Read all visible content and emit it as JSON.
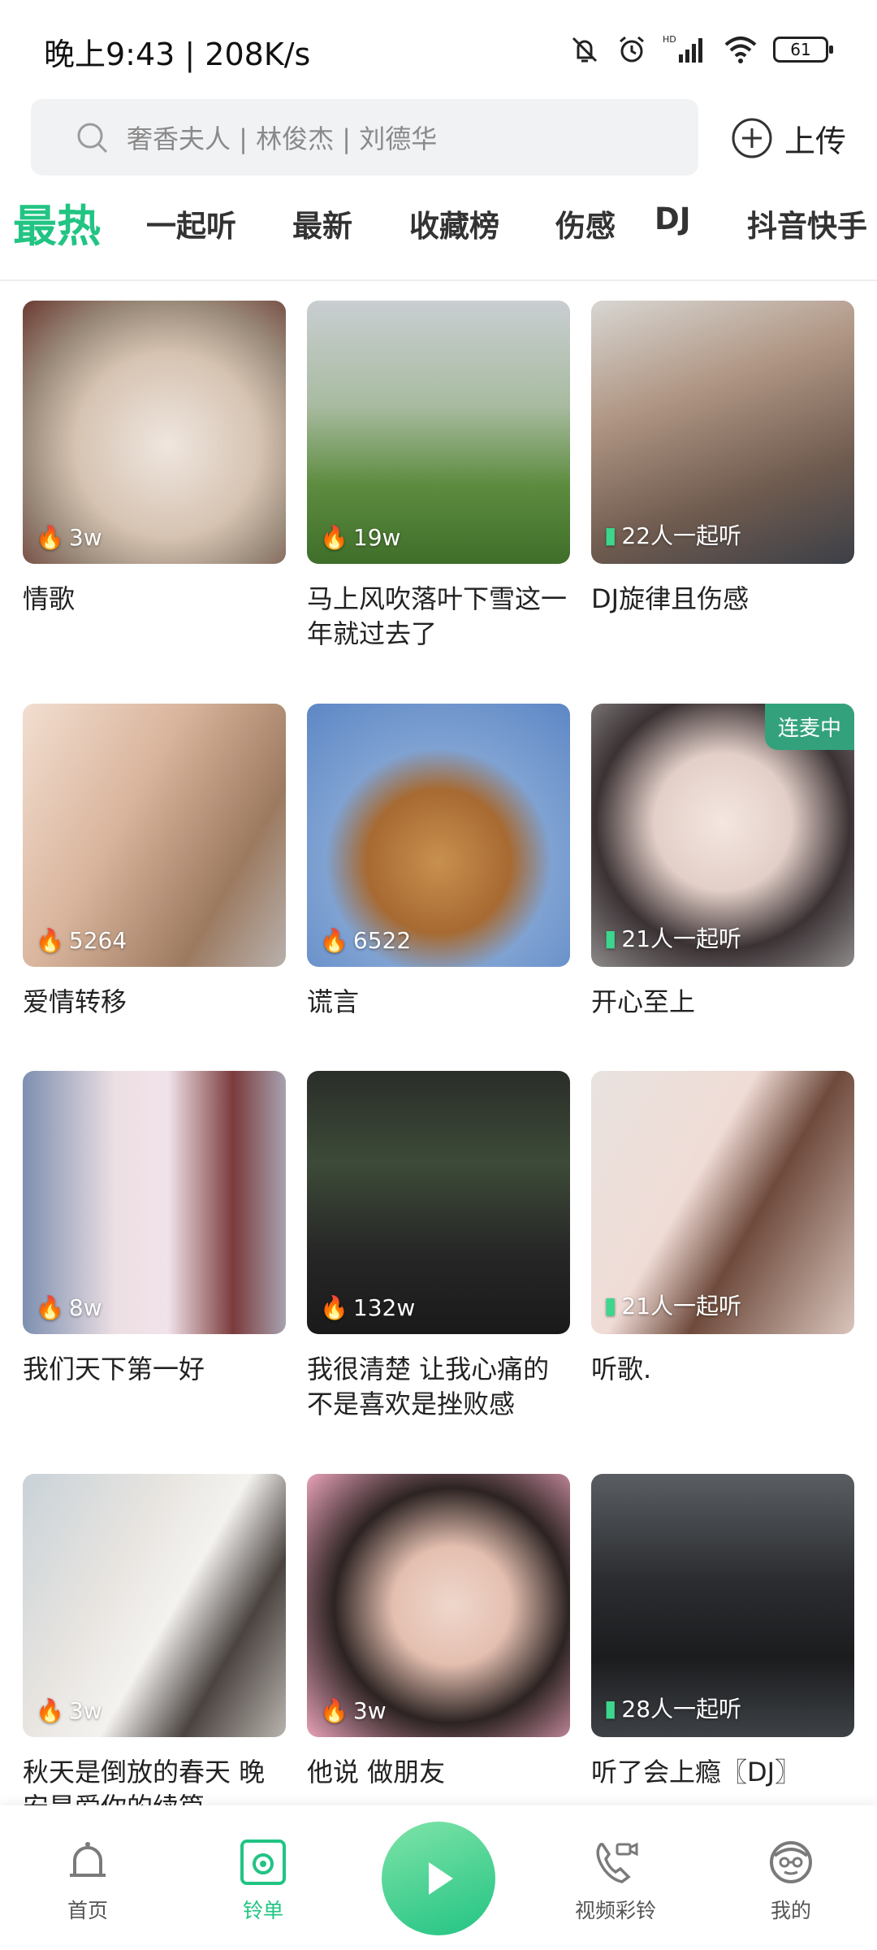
{
  "status_bar": {
    "time": "晚上9:43 | 208K/s",
    "battery": "61",
    "icons": [
      "bell-off-icon",
      "alarm-icon",
      "hd-signal-icon",
      "wifi-icon",
      "battery-icon"
    ]
  },
  "search": {
    "placeholder": "奢香夫人 | 林俊杰 | 刘德华",
    "upload_label": "上传"
  },
  "tabs": [
    {
      "label": "最热",
      "active": true
    },
    {
      "label": "一起听"
    },
    {
      "label": "最新"
    },
    {
      "label": "收藏榜"
    },
    {
      "label": "伤感"
    },
    {
      "label": "DJ"
    },
    {
      "label": "抖音快手"
    }
  ],
  "cards": [
    {
      "title": "情歌",
      "stat": "3w",
      "stat_type": "fire"
    },
    {
      "title": "马上风吹落叶下雪这一年就过去了",
      "stat": "19w",
      "stat_type": "fire"
    },
    {
      "title": "DJ旋律且伤感",
      "stat": "22人一起听",
      "stat_type": "listen"
    },
    {
      "title": "爱情转移",
      "stat": "5264",
      "stat_type": "fire"
    },
    {
      "title": "谎言",
      "stat": "6522",
      "stat_type": "fire"
    },
    {
      "title": "开心至上",
      "stat": "21人一起听",
      "stat_type": "listen",
      "badge": "连麦中"
    },
    {
      "title": "我们天下第一好",
      "stat": "8w",
      "stat_type": "fire"
    },
    {
      "title": "我很清楚 让我心痛的不是喜欢是挫败感",
      "stat": "132w",
      "stat_type": "fire"
    },
    {
      "title": "听歌.",
      "stat": "21人一起听",
      "stat_type": "listen"
    },
    {
      "title": "秋天是倒放的春天 晚安是爱你的续篇",
      "stat": "3w",
      "stat_type": "fire"
    },
    {
      "title": "他说 做朋友",
      "stat": "3w",
      "stat_type": "fire"
    },
    {
      "title": "听了会上瘾〖DJ〗",
      "stat": "28人一起听",
      "stat_type": "listen"
    }
  ],
  "nav": [
    {
      "label": "首页",
      "icon": "bell-icon"
    },
    {
      "label": "铃单",
      "icon": "ringlist-icon",
      "active": true
    },
    {
      "label": "",
      "icon": "play-icon"
    },
    {
      "label": "视频彩铃",
      "icon": "video-call-icon"
    },
    {
      "label": "我的",
      "icon": "avatar-icon"
    }
  ],
  "colors": {
    "accent": "#22c483",
    "listen": "#33a27c"
  }
}
